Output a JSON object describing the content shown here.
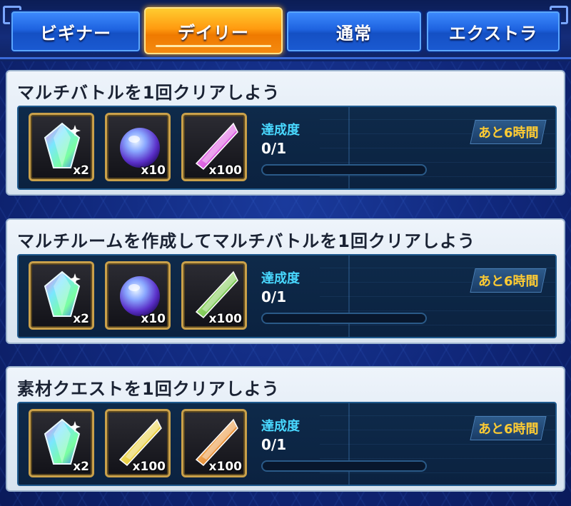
{
  "tabs": [
    {
      "label": "ビギナー",
      "active": false
    },
    {
      "label": "デイリー",
      "active": true
    },
    {
      "label": "通常",
      "active": false
    },
    {
      "label": "エクストラ",
      "active": false
    }
  ],
  "missions": [
    {
      "title": "マルチバトルを1回クリアしよう",
      "rewards": [
        {
          "icon": "rainbow-crystal-icon",
          "qty": "x2"
        },
        {
          "icon": "purple-orb-icon",
          "qty": "x10"
        },
        {
          "icon": "pink-shard-icon",
          "qty": "x100"
        }
      ],
      "progress_label": "達成度",
      "progress_value": "0/1",
      "progress_fraction": 0,
      "time_left": "あと6時間"
    },
    {
      "title": "マルチルームを作成してマルチバトルを1回クリアしよう",
      "rewards": [
        {
          "icon": "rainbow-crystal-icon",
          "qty": "x2"
        },
        {
          "icon": "purple-orb-icon",
          "qty": "x10"
        },
        {
          "icon": "green-shard-icon",
          "qty": "x100"
        }
      ],
      "progress_label": "達成度",
      "progress_value": "0/1",
      "progress_fraction": 0,
      "time_left": "あと6時間"
    },
    {
      "title": "素材クエストを1回クリアしよう",
      "rewards": [
        {
          "icon": "rainbow-crystal-icon",
          "qty": "x2"
        },
        {
          "icon": "yellow-shard-icon",
          "qty": "x100"
        },
        {
          "icon": "orange-shard-icon",
          "qty": "x100"
        }
      ],
      "progress_label": "達成度",
      "progress_value": "0/1",
      "progress_fraction": 0,
      "time_left": "あと6時間"
    }
  ],
  "colors": {
    "accent_orange": "#ff9b10",
    "progress_label": "#49d8ff",
    "time_text": "#ffcc33",
    "frame_gold": "#c9a04a"
  }
}
